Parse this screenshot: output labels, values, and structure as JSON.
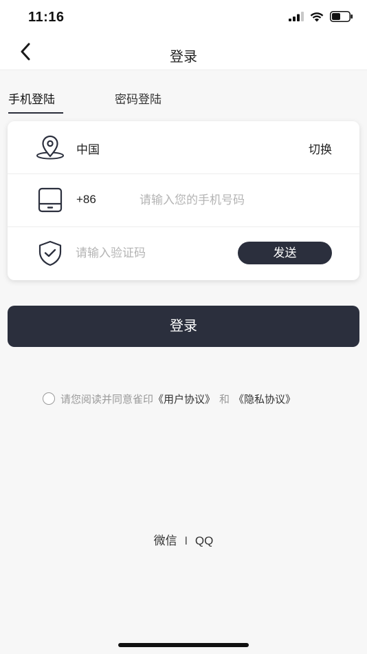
{
  "status_bar": {
    "time": "11:16",
    "icons": [
      "signal-icon",
      "wifi-icon",
      "battery-icon"
    ]
  },
  "nav": {
    "back_icon": "chevron-left-icon",
    "title": "登录"
  },
  "tabs": [
    {
      "label": "手机登陆",
      "active": true
    },
    {
      "label": "密码登陆",
      "active": false
    }
  ],
  "form": {
    "country": {
      "icon": "location-pin-icon",
      "value": "中国",
      "switch_label": "切换"
    },
    "phone": {
      "icon": "phone-device-icon",
      "code": "+86",
      "value": "",
      "placeholder": "请输入您的手机号码"
    },
    "verify": {
      "icon": "shield-check-icon",
      "value": "",
      "placeholder": "请输入验证码",
      "send_label": "发送"
    }
  },
  "login_button": "登录",
  "agreement": {
    "checked": false,
    "text": "请您阅读并同意雀印",
    "user_agreement": "《用户协议》",
    "and": "和",
    "privacy_policy": "《隐私协议》"
  },
  "third_party": {
    "wechat": "微信",
    "separator": "I",
    "qq": "QQ"
  },
  "colors": {
    "primary_dark": "#2b2f3d",
    "background": "#f7f7f7",
    "placeholder": "#b4b4b4",
    "muted_text": "#9a9a9a"
  }
}
